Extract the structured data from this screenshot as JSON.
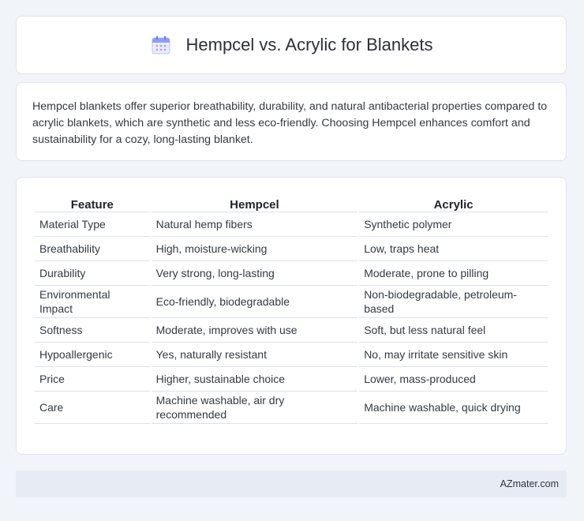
{
  "header": {
    "title": "Hempcel vs. Acrylic for Blankets",
    "icon": "calendar-icon"
  },
  "intro": {
    "text": "Hempcel blankets offer superior breathability, durability, and natural antibacterial properties compared to acrylic blankets, which are synthetic and less eco-friendly. Choosing Hempcel enhances comfort and sustainability for a cozy, long-lasting blanket."
  },
  "table": {
    "headers": [
      "Feature",
      "Hempcel",
      "Acrylic"
    ],
    "rows": [
      [
        "Material Type",
        "Natural hemp fibers",
        "Synthetic polymer"
      ],
      [
        "Breathability",
        "High, moisture-wicking",
        "Low, traps heat"
      ],
      [
        "Durability",
        "Very strong, long-lasting",
        "Moderate, prone to pilling"
      ],
      [
        "Environmental Impact",
        "Eco-friendly, biodegradable",
        "Non-biodegradable, petroleum-based"
      ],
      [
        "Softness",
        "Moderate, improves with use",
        "Soft, but less natural feel"
      ],
      [
        "Hypoallergenic",
        "Yes, naturally resistant",
        "No, may irritate sensitive skin"
      ],
      [
        "Price",
        "Higher, sustainable choice",
        "Lower, mass-produced"
      ],
      [
        "Care",
        "Machine washable, air dry recommended",
        "Machine washable, quick drying"
      ]
    ]
  },
  "footer": {
    "text": "AZmater.com"
  },
  "colors": {
    "background": "#f1f4f9",
    "card": "#ffffff",
    "footer": "#e6ebf4",
    "icon_accent": "#7b8cf0"
  }
}
